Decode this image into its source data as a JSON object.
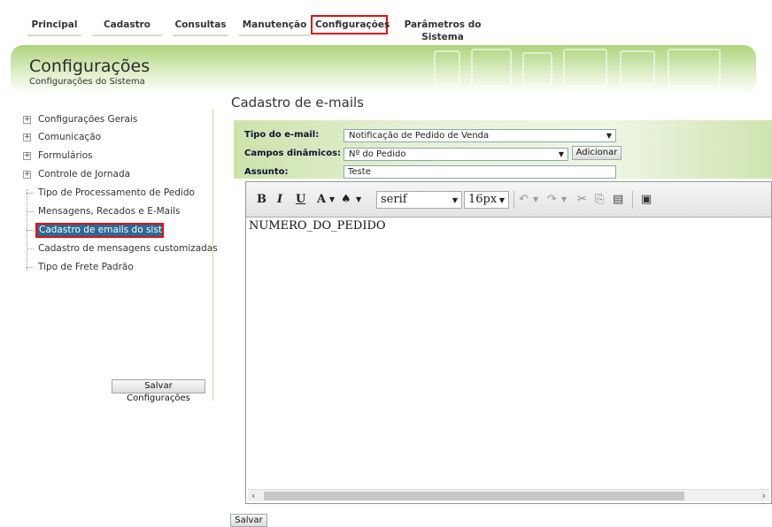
{
  "nav": {
    "items": [
      "Principal",
      "Cadastro",
      "Consultas",
      "Manutenção",
      "Configurações",
      "Parâmetros do Sistema"
    ]
  },
  "banner": {
    "title": "Configurações",
    "subtitle": "Configurações do Sistema"
  },
  "sidebar": {
    "groups": [
      "Configurações Gerais",
      "Comunicação",
      "Formulários",
      "Controle de Jornada"
    ],
    "items": [
      "Tipo de Processamento de Pedido",
      "Mensagens, Recados e E-Mails",
      "Cadastro de emails do sistema",
      "Cadastro de mensagens customizadas",
      "Tipo de Frete Padrão"
    ],
    "selected": "Cadastro de emails do sistema",
    "save_label": "Salvar Configurações"
  },
  "main": {
    "title": "Cadastro de e-mails",
    "email_type_label": "Tipo do e-mail:",
    "email_type_value": "Notificação de Pedido de Venda",
    "dynamic_fields_label": "Campos dinâmicos:",
    "dynamic_fields_value": "Nº do Pedido",
    "add_label": "Adicionar",
    "subject_label": "Assunto:",
    "subject_value": "Teste",
    "save_label": "Salvar"
  },
  "editor": {
    "font_family": "serif",
    "font_size": "16px",
    "content": "NUMERO_DO_PEDIDO"
  },
  "colors": {
    "accent": "#aed37c",
    "selection": "#2a6a96",
    "highlight_border": "#e01010"
  }
}
